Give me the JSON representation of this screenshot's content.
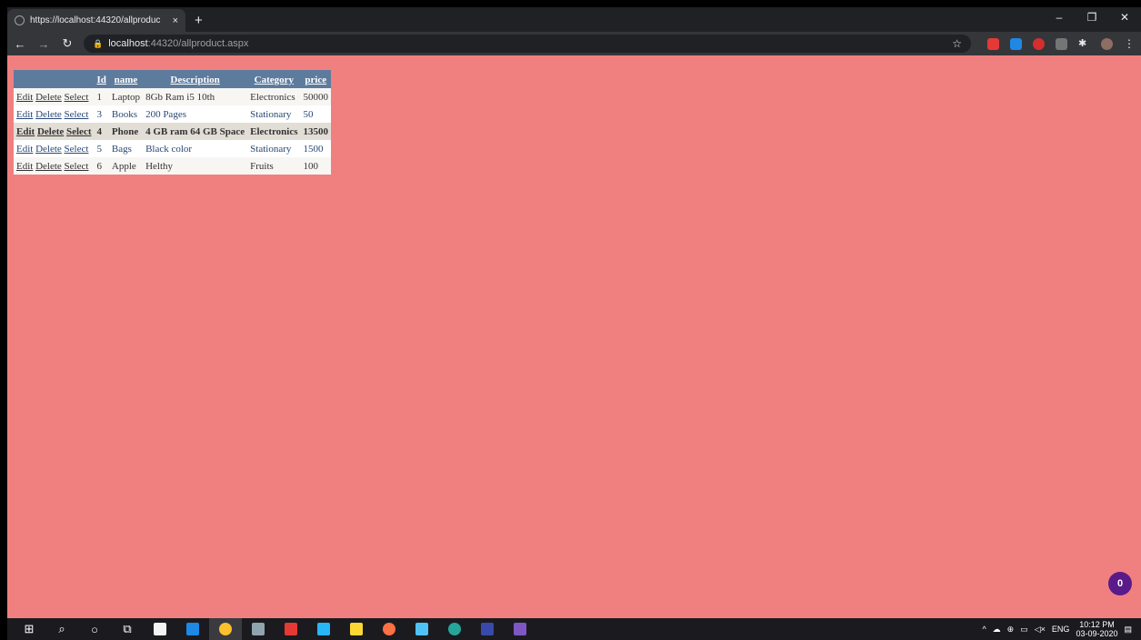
{
  "browser": {
    "tab_title": "https://localhost:44320/allproduc",
    "tab_close": "×",
    "new_tab": "+",
    "url_host": "localhost",
    "url_rest": ":44320/allproduct.aspx"
  },
  "grid": {
    "headers": [
      "",
      "Id",
      "name",
      "Description",
      "Category",
      "price"
    ],
    "actions": {
      "edit": "Edit",
      "delete": "Delete",
      "select": "Select"
    },
    "rows": [
      {
        "id": "1",
        "name": "Laptop",
        "description": "8Gb Ram i5 10th",
        "category": "Electronics",
        "price": "50000"
      },
      {
        "id": "3",
        "name": "Books",
        "description": "200 Pages",
        "category": "Stationary",
        "price": "50"
      },
      {
        "id": "4",
        "name": "Phone",
        "description": "4 GB ram 64 GB Space",
        "category": "Electronics",
        "price": "13500"
      },
      {
        "id": "5",
        "name": "Bags",
        "description": "Black color",
        "category": "Stationary",
        "price": "1500"
      },
      {
        "id": "6",
        "name": "Apple",
        "description": "Helthy",
        "category": "Fruits",
        "price": "100"
      }
    ]
  },
  "badge": {
    "count": "0"
  },
  "taskbar": {
    "lang": "ENG",
    "time": "10:12 PM",
    "date": "03-09-2020"
  },
  "colors": {
    "page_background": "#f08080",
    "grid_header": "#5d7b9d",
    "selected_row": "#e2ded6"
  }
}
